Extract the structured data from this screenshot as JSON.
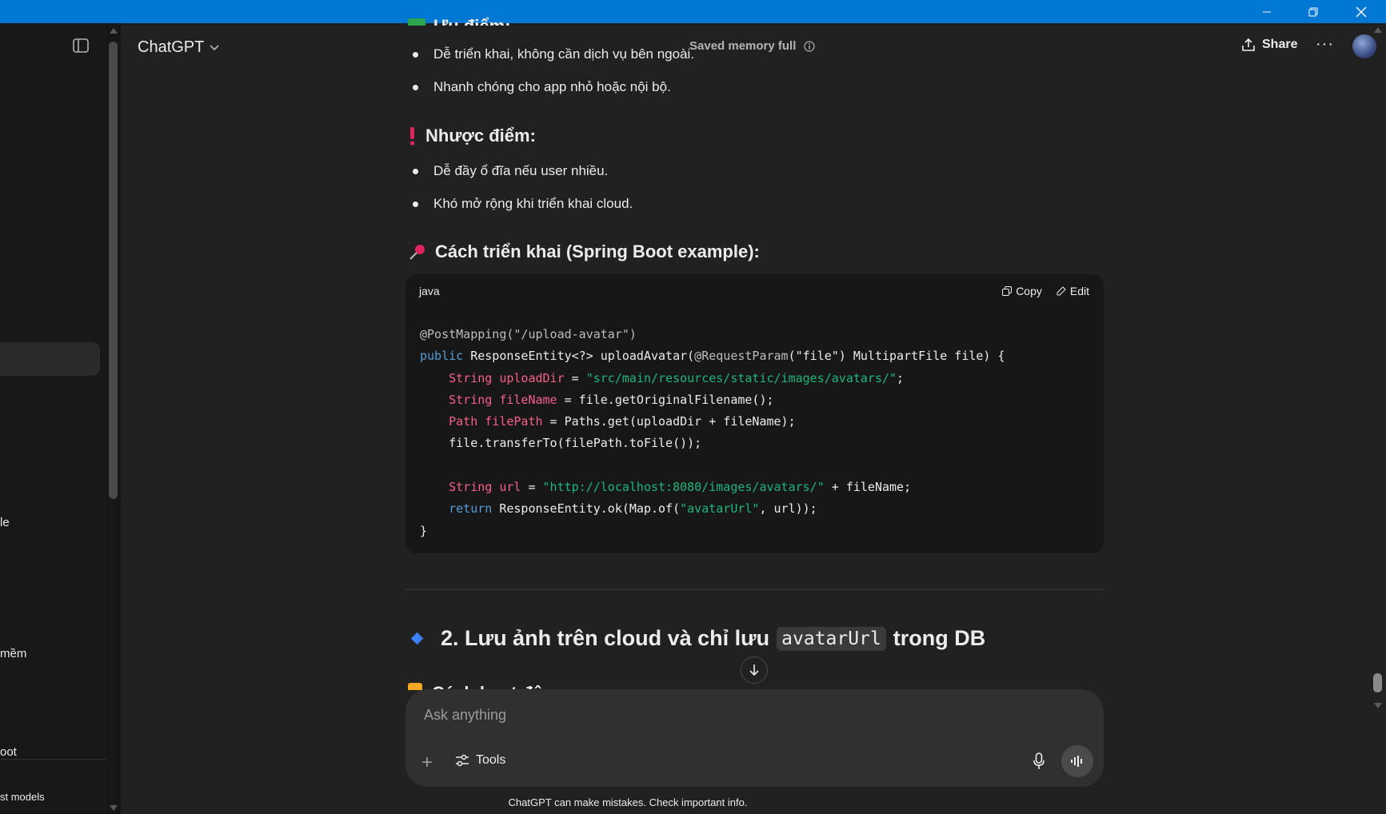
{
  "window": {
    "minimize_icon": "minimize-icon",
    "restore_icon": "restore-icon",
    "close_icon": "close-icon"
  },
  "sidebar": {
    "items": [
      {
        "label": "le"
      },
      {
        "label": "mềm"
      },
      {
        "label": "oot"
      },
      {
        "label": "st models"
      }
    ]
  },
  "header": {
    "title": "ChatGPT",
    "memory_status": "Saved memory full",
    "share_label": "Share",
    "more_label": "···"
  },
  "content": {
    "top_heading_peek": "Ưu điểm:",
    "pros": [
      "Dễ triển khai, không cần dịch vụ bên ngoài.",
      "Nhanh chóng cho app nhỏ hoặc nội bộ."
    ],
    "cons_heading": "Nhược điểm:",
    "cons": [
      "Dễ đầy ổ đĩa nếu user nhiều.",
      "Khó mở rộng khi triển khai cloud."
    ],
    "impl_heading": "Cách triển khai (Spring Boot example):",
    "code": {
      "language": "java",
      "copy_label": "Copy",
      "edit_label": "Edit"
    },
    "section2": {
      "prefix": "2. Lưu ảnh trên cloud và chỉ lưu",
      "inline_code": "avatarUrl",
      "suffix": "trong DB"
    },
    "next_peek": "Cách hoạt động:"
  },
  "composer": {
    "placeholder": "Ask anything",
    "tools_label": "Tools"
  },
  "footer": {
    "disclaimer": "ChatGPT can make mistakes. Check important info."
  },
  "colors": {
    "titlebar": "#0078d4",
    "background": "#212121",
    "sidebar": "#181818",
    "code_keyword": "#569cd6",
    "code_type": "#f7608a",
    "code_string": "#1fb57d"
  }
}
